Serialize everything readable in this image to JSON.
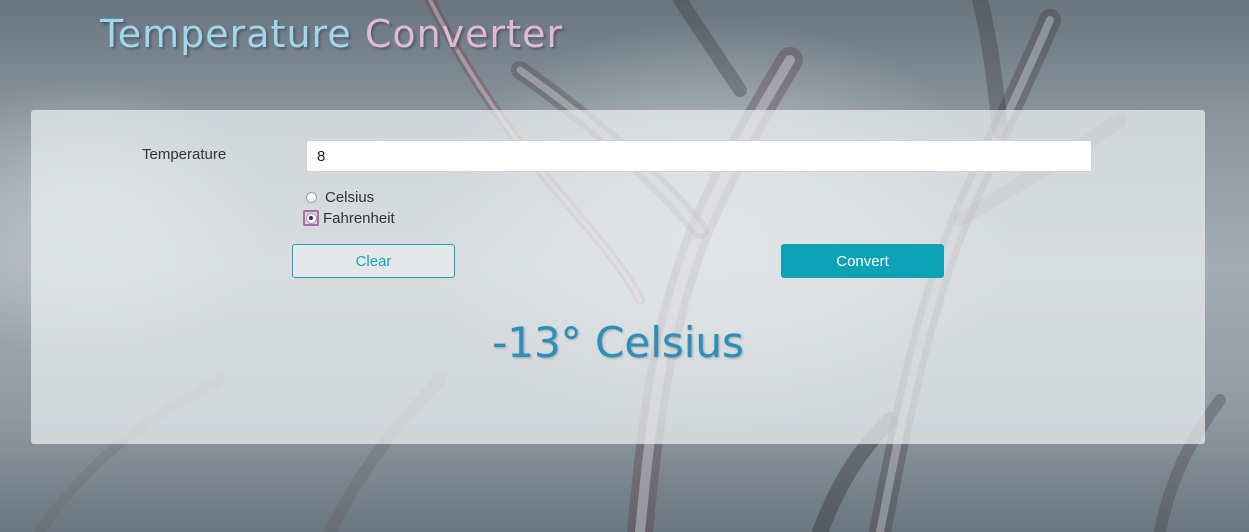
{
  "app": {
    "title_part1": "Temperature",
    "title_part2": "Converter"
  },
  "form": {
    "temperature_label": "Temperature",
    "temperature_value": "8",
    "unit_options": [
      {
        "label": "Celsius",
        "selected": false
      },
      {
        "label": "Fahrenheit",
        "selected": true
      }
    ],
    "clear_label": "Clear",
    "convert_label": "Convert"
  },
  "result": {
    "text": "-13° Celsius"
  },
  "colors": {
    "accent": "#0ea2b6",
    "result": "#2a90b8",
    "title": "#9fd7ec",
    "title_accent": "#e0b9d6",
    "focus_ring": "#b06aa8"
  },
  "icons": {
    "background": "frozen-branches-image"
  }
}
